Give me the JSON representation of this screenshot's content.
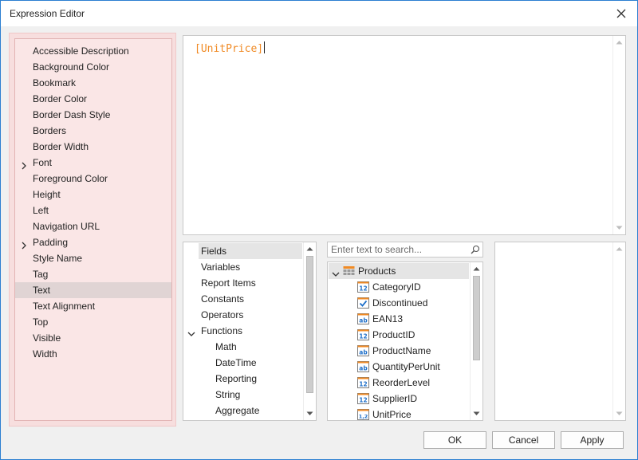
{
  "window": {
    "title": "Expression Editor"
  },
  "properties": [
    {
      "label": "Accessible Description",
      "expandable": false,
      "selected": false
    },
    {
      "label": "Background Color",
      "expandable": false,
      "selected": false
    },
    {
      "label": "Bookmark",
      "expandable": false,
      "selected": false
    },
    {
      "label": "Border Color",
      "expandable": false,
      "selected": false
    },
    {
      "label": "Border Dash Style",
      "expandable": false,
      "selected": false
    },
    {
      "label": "Borders",
      "expandable": false,
      "selected": false
    },
    {
      "label": "Border Width",
      "expandable": false,
      "selected": false
    },
    {
      "label": "Font",
      "expandable": true,
      "selected": false
    },
    {
      "label": "Foreground Color",
      "expandable": false,
      "selected": false
    },
    {
      "label": "Height",
      "expandable": false,
      "selected": false
    },
    {
      "label": "Left",
      "expandable": false,
      "selected": false
    },
    {
      "label": "Navigation URL",
      "expandable": false,
      "selected": false
    },
    {
      "label": "Padding",
      "expandable": true,
      "selected": false
    },
    {
      "label": "Style Name",
      "expandable": false,
      "selected": false
    },
    {
      "label": "Tag",
      "expandable": false,
      "selected": false
    },
    {
      "label": "Text",
      "expandable": false,
      "selected": true
    },
    {
      "label": "Text Alignment",
      "expandable": false,
      "selected": false
    },
    {
      "label": "Top",
      "expandable": false,
      "selected": false
    },
    {
      "label": "Visible",
      "expandable": false,
      "selected": false
    },
    {
      "label": "Width",
      "expandable": false,
      "selected": false
    }
  ],
  "expression": {
    "text": "[UnitPrice]"
  },
  "categories": [
    {
      "label": "Fields",
      "level": 0,
      "expanded": null,
      "selected": true
    },
    {
      "label": "Variables",
      "level": 0,
      "expanded": null,
      "selected": false
    },
    {
      "label": "Report Items",
      "level": 0,
      "expanded": null,
      "selected": false
    },
    {
      "label": "Constants",
      "level": 0,
      "expanded": null,
      "selected": false
    },
    {
      "label": "Operators",
      "level": 0,
      "expanded": null,
      "selected": false
    },
    {
      "label": "Functions",
      "level": 0,
      "expanded": true,
      "selected": false
    },
    {
      "label": "Math",
      "level": 1,
      "expanded": null,
      "selected": false
    },
    {
      "label": "DateTime",
      "level": 1,
      "expanded": null,
      "selected": false
    },
    {
      "label": "Reporting",
      "level": 1,
      "expanded": null,
      "selected": false
    },
    {
      "label": "String",
      "level": 1,
      "expanded": null,
      "selected": false
    },
    {
      "label": "Aggregate",
      "level": 1,
      "expanded": null,
      "selected": false
    }
  ],
  "search": {
    "placeholder": "Enter text to search...",
    "value": ""
  },
  "fields_tree": [
    {
      "label": "Products",
      "icon": "table-icon",
      "level": 0,
      "expanded": true,
      "selected": true
    },
    {
      "label": "CategoryID",
      "icon": "number-icon",
      "level": 1,
      "selected": false
    },
    {
      "label": "Discontinued",
      "icon": "boolean-icon",
      "level": 1,
      "selected": false
    },
    {
      "label": "EAN13",
      "icon": "string-icon",
      "level": 1,
      "selected": false
    },
    {
      "label": "ProductID",
      "icon": "number-icon",
      "level": 1,
      "selected": false
    },
    {
      "label": "ProductName",
      "icon": "string-icon",
      "level": 1,
      "selected": false
    },
    {
      "label": "QuantityPerUnit",
      "icon": "string-icon",
      "level": 1,
      "selected": false
    },
    {
      "label": "ReorderLevel",
      "icon": "number-icon",
      "level": 1,
      "selected": false
    },
    {
      "label": "SupplierID",
      "icon": "number-icon",
      "level": 1,
      "selected": false
    },
    {
      "label": "UnitPrice",
      "icon": "decimal-icon",
      "level": 1,
      "selected": false
    }
  ],
  "icon_glyphs": {
    "number-icon": "12",
    "string-icon": "ab",
    "decimal-icon": "1,2"
  },
  "buttons": {
    "ok": "OK",
    "cancel": "Cancel",
    "apply": "Apply"
  },
  "colors": {
    "accent_blue": "#1e6fc9",
    "expression_text": "#f08a24",
    "property_panel_bg": "#fae6e6",
    "icon_orange": "#f08a24",
    "check_blue": "#1e6fc9"
  }
}
